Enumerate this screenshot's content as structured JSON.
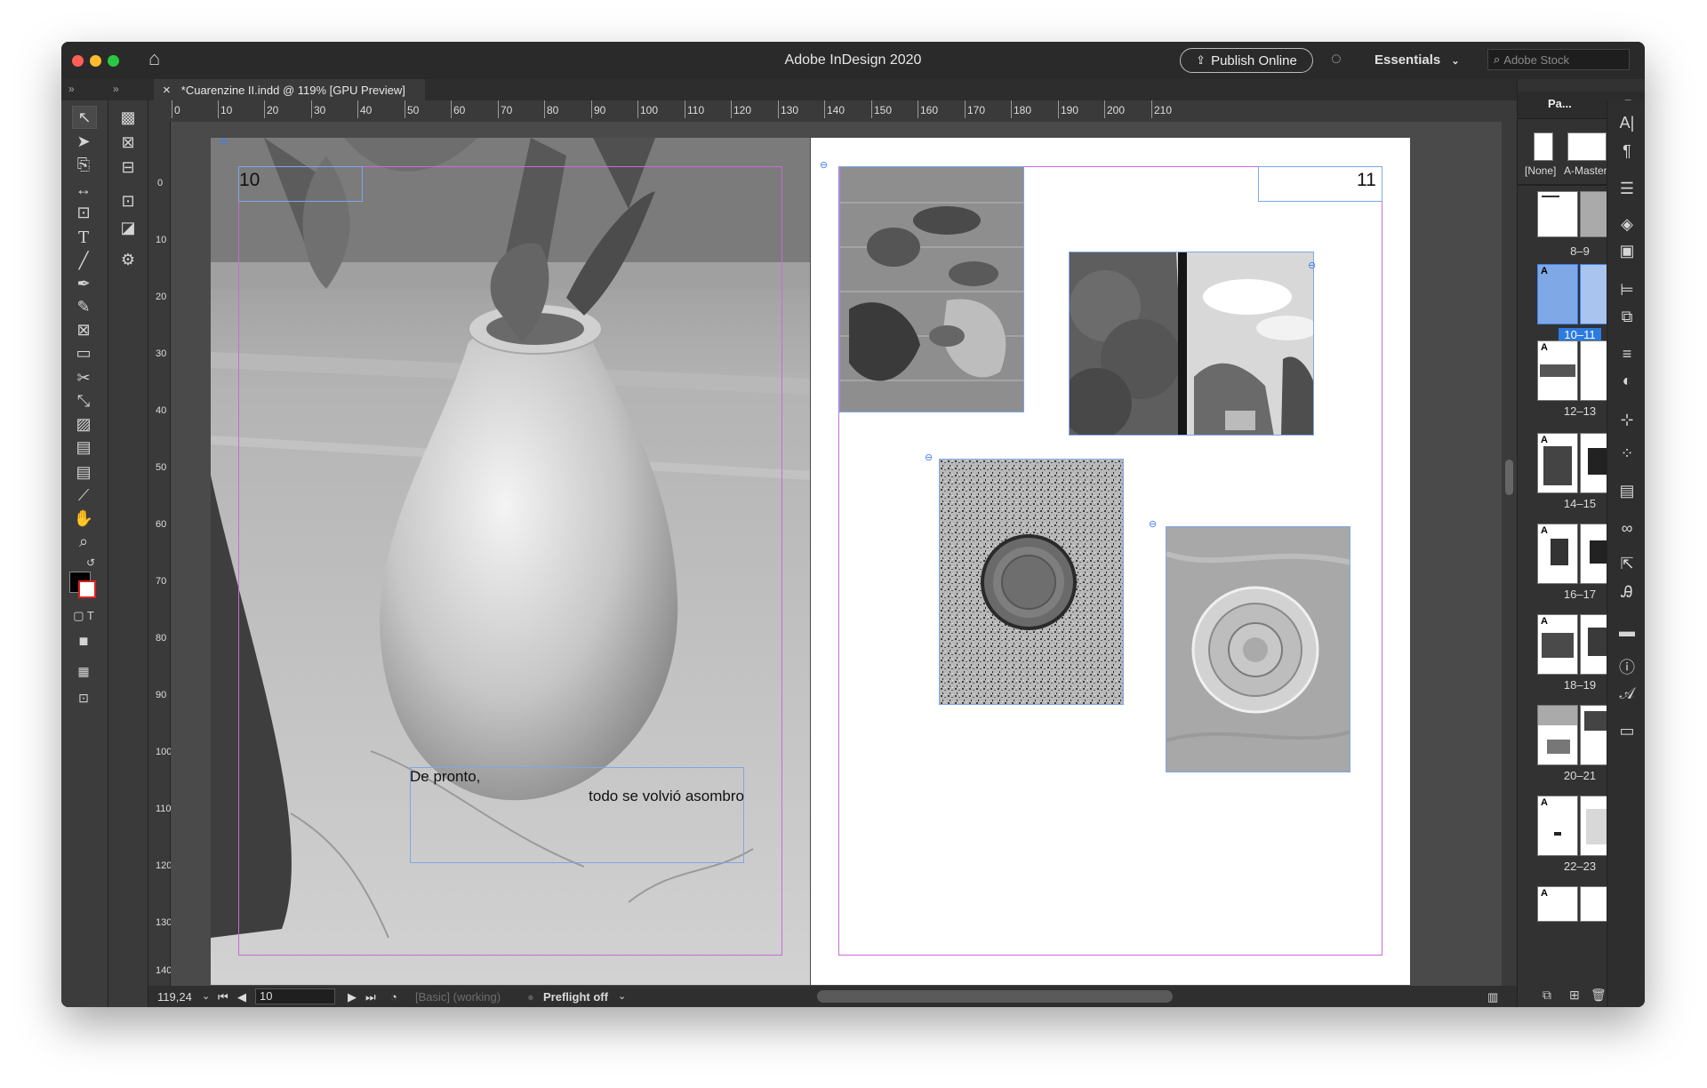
{
  "app": {
    "title": "Adobe InDesign 2020",
    "publish_label": "Publish Online",
    "workspace": "Essentials",
    "search_placeholder": "Adobe Stock"
  },
  "document": {
    "tab_title": "*Cuarenzine II.indd @ 119% [GPU Preview]",
    "close_icon": "×"
  },
  "ruler": {
    "horizontal": [
      "0",
      "10",
      "20",
      "30",
      "40",
      "50",
      "60",
      "70",
      "80",
      "90",
      "100",
      "110",
      "120",
      "130",
      "140",
      "150",
      "160",
      "170",
      "180",
      "190",
      "200",
      "210"
    ],
    "vertical": [
      "0",
      "10",
      "20",
      "30",
      "40",
      "50",
      "60",
      "70",
      "80",
      "90",
      "100",
      "110",
      "120",
      "130",
      "140"
    ]
  },
  "spread": {
    "left_page_number": "10",
    "right_page_number": "11",
    "text_line_1": "De pronto,",
    "text_line_2": "todo se volvió asombro"
  },
  "status": {
    "zoom": "119,24",
    "page_field": "10",
    "style": "[Basic] (working)",
    "preflight": "Preflight off"
  },
  "pages_panel": {
    "tab_label": "Pa...",
    "master_none": "[None]",
    "master_a": "A-Master",
    "spreads": [
      "8–9",
      "10–11",
      "12–13",
      "14–15",
      "16–17",
      "18–19",
      "20–21",
      "22–23"
    ],
    "master_tag": "A"
  }
}
